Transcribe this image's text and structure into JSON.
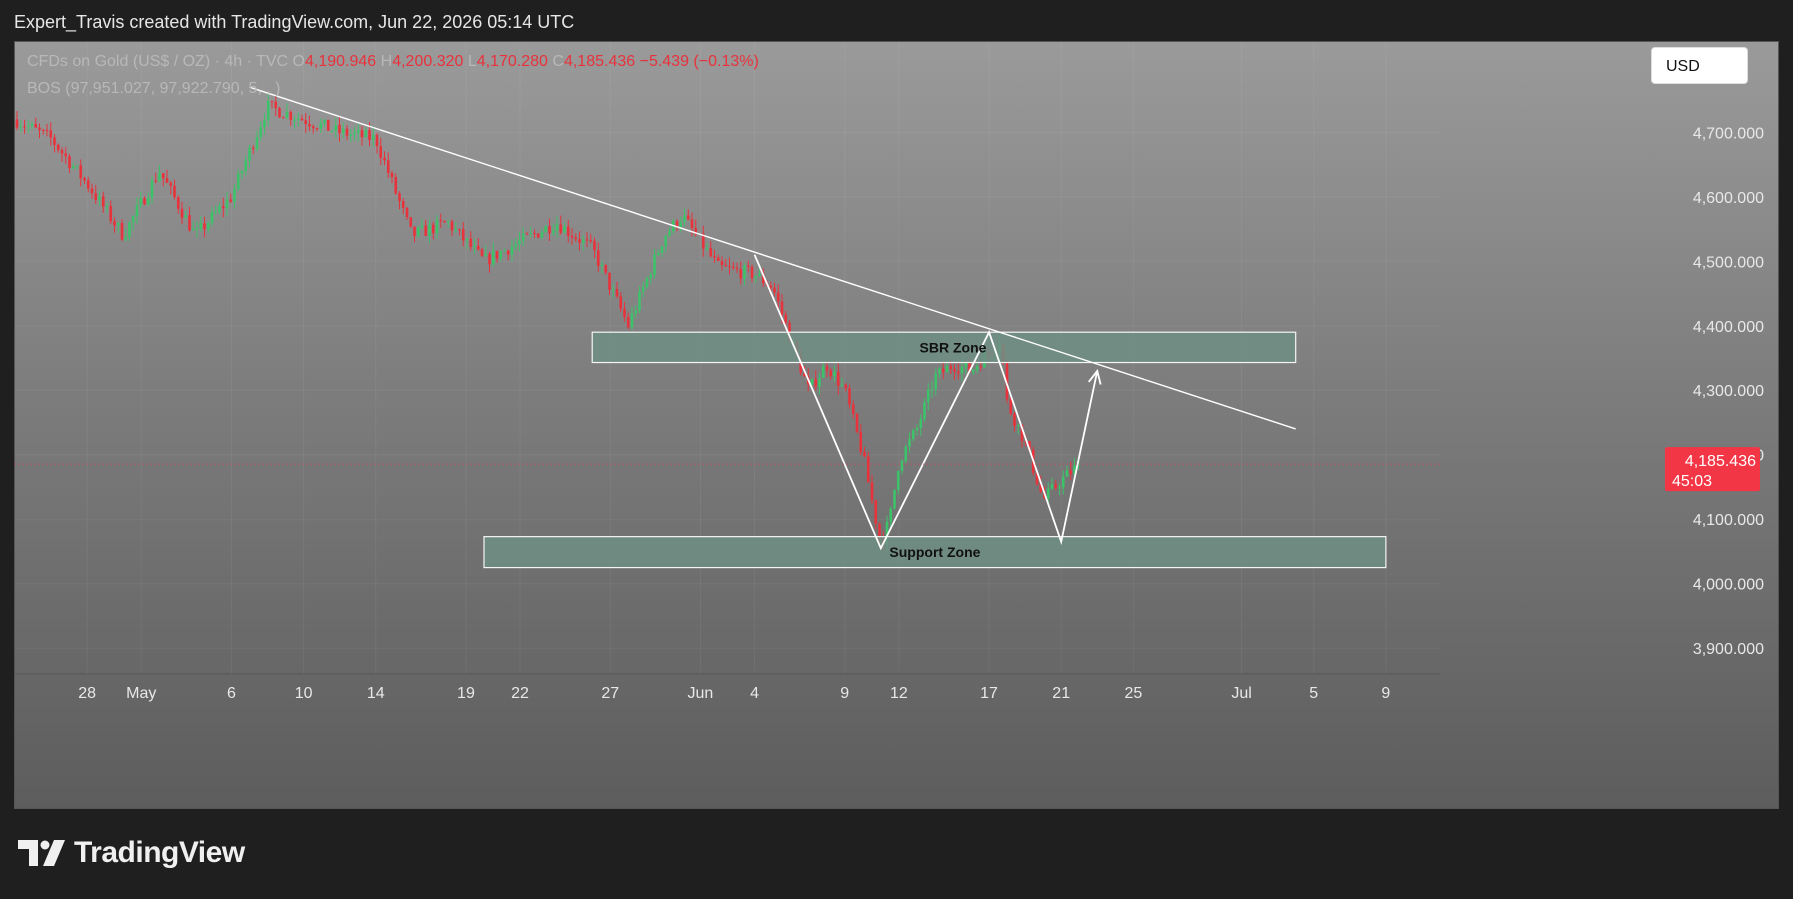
{
  "header": {
    "attribution": "Expert_Travis created with TradingView.com, Jun 22, 2026 05:14 UTC"
  },
  "legend": {
    "symbol": "CFDs on Gold (US$ / OZ) · 4h · TVC",
    "open_label": "O",
    "open": "4,190.946",
    "high_label": "H",
    "high": "4,200.320",
    "low_label": "L",
    "low": "4,170.280",
    "close_label": "C",
    "close": "4,185.436",
    "change": "−5.439 (−0.13%)",
    "indicator": "BOS (97,951.027, 97,922.790, 5, , )"
  },
  "currency_button": "USD",
  "brand": {
    "name": "TradingView",
    "icon": "tradingview-logo-icon"
  },
  "colors": {
    "up": "#3cc36a",
    "down": "#e8323c",
    "zone_fill": "#6e8f84",
    "line": "#ffffff",
    "price_tag": "#f23645"
  },
  "chart_data": {
    "type": "candlestick",
    "symbol": "CFDs on Gold (US$ / OZ)",
    "timeframe": "4h",
    "ylim": [
      3860,
      4840
    ],
    "y_ticks": [
      "4,700.000",
      "4,600.000",
      "4,500.000",
      "4,400.000",
      "4,300.000",
      "4,200.000",
      "4,100.000",
      "4,000.000",
      "3,900.000"
    ],
    "y_tick_values": [
      4700,
      4600,
      4500,
      4400,
      4300,
      4200,
      4100,
      4000,
      3900
    ],
    "x_ticks": [
      "28",
      "May",
      "6",
      "10",
      "14",
      "19",
      "22",
      "27",
      "Jun",
      "4",
      "9",
      "12",
      "17",
      "21",
      "25",
      "Jul",
      "5",
      "9"
    ],
    "x_tick_dates": [
      "2026-04-28",
      "2026-05-01",
      "2026-05-06",
      "2026-05-10",
      "2026-05-14",
      "2026-05-19",
      "2026-05-22",
      "2026-05-27",
      "2026-06-01",
      "2026-06-04",
      "2026-06-09",
      "2026-06-12",
      "2026-06-17",
      "2026-06-21",
      "2026-06-25",
      "2026-07-01",
      "2026-07-05",
      "2026-07-09"
    ],
    "grid": true,
    "last_price": "4,185.436",
    "last_price_value": 4185.436,
    "countdown": "45:03",
    "price_path": [
      [
        "2026-04-24",
        4720
      ],
      [
        "2026-04-26",
        4690
      ],
      [
        "2026-04-28",
        4620
      ],
      [
        "2026-04-30",
        4540
      ],
      [
        "2026-05-02",
        4640
      ],
      [
        "2026-05-04",
        4540
      ],
      [
        "2026-05-06",
        4600
      ],
      [
        "2026-05-08",
        4740
      ],
      [
        "2026-05-10",
        4720
      ],
      [
        "2026-05-12",
        4700
      ],
      [
        "2026-05-14",
        4690
      ],
      [
        "2026-05-16",
        4540
      ],
      [
        "2026-05-18",
        4560
      ],
      [
        "2026-05-20",
        4500
      ],
      [
        "2026-05-22",
        4530
      ],
      [
        "2026-05-24",
        4560
      ],
      [
        "2026-05-26",
        4520
      ],
      [
        "2026-05-28",
        4400
      ],
      [
        "2026-05-30",
        4540
      ],
      [
        "2026-05-31",
        4570
      ],
      [
        "2026-06-02",
        4490
      ],
      [
        "2026-06-04",
        4480
      ],
      [
        "2026-06-05",
        4460
      ],
      [
        "2026-06-06",
        4380
      ],
      [
        "2026-06-07",
        4300
      ],
      [
        "2026-06-08",
        4340
      ],
      [
        "2026-06-09",
        4300
      ],
      [
        "2026-06-10",
        4200
      ],
      [
        "2026-06-11",
        4060
      ],
      [
        "2026-06-11T12",
        4100
      ],
      [
        "2026-06-12",
        4190
      ],
      [
        "2026-06-13",
        4240
      ],
      [
        "2026-06-14",
        4320
      ],
      [
        "2026-06-15",
        4340
      ],
      [
        "2026-06-16",
        4330
      ],
      [
        "2026-06-17",
        4360
      ],
      [
        "2026-06-17T16",
        4380
      ],
      [
        "2026-06-18",
        4280
      ],
      [
        "2026-06-19",
        4220
      ],
      [
        "2026-06-20",
        4130
      ],
      [
        "2026-06-21",
        4160
      ],
      [
        "2026-06-22",
        4185
      ]
    ],
    "trendline": {
      "from": [
        "2026-05-07",
        4770
      ],
      "to": [
        "2026-07-04",
        4240
      ]
    },
    "zones": [
      {
        "label": "SBR Zone",
        "from": "2026-05-26",
        "to": "2026-07-04",
        "low": 4343,
        "high": 4390
      },
      {
        "label": "Support Zone",
        "from": "2026-05-20",
        "to": "2026-07-09",
        "low": 4025,
        "high": 4073
      }
    ],
    "projection": [
      [
        "2026-06-04",
        4510
      ],
      [
        "2026-06-11",
        4055
      ],
      [
        "2026-06-17",
        4390
      ],
      [
        "2026-06-21",
        4065
      ],
      [
        "2026-06-23",
        4330
      ]
    ]
  }
}
